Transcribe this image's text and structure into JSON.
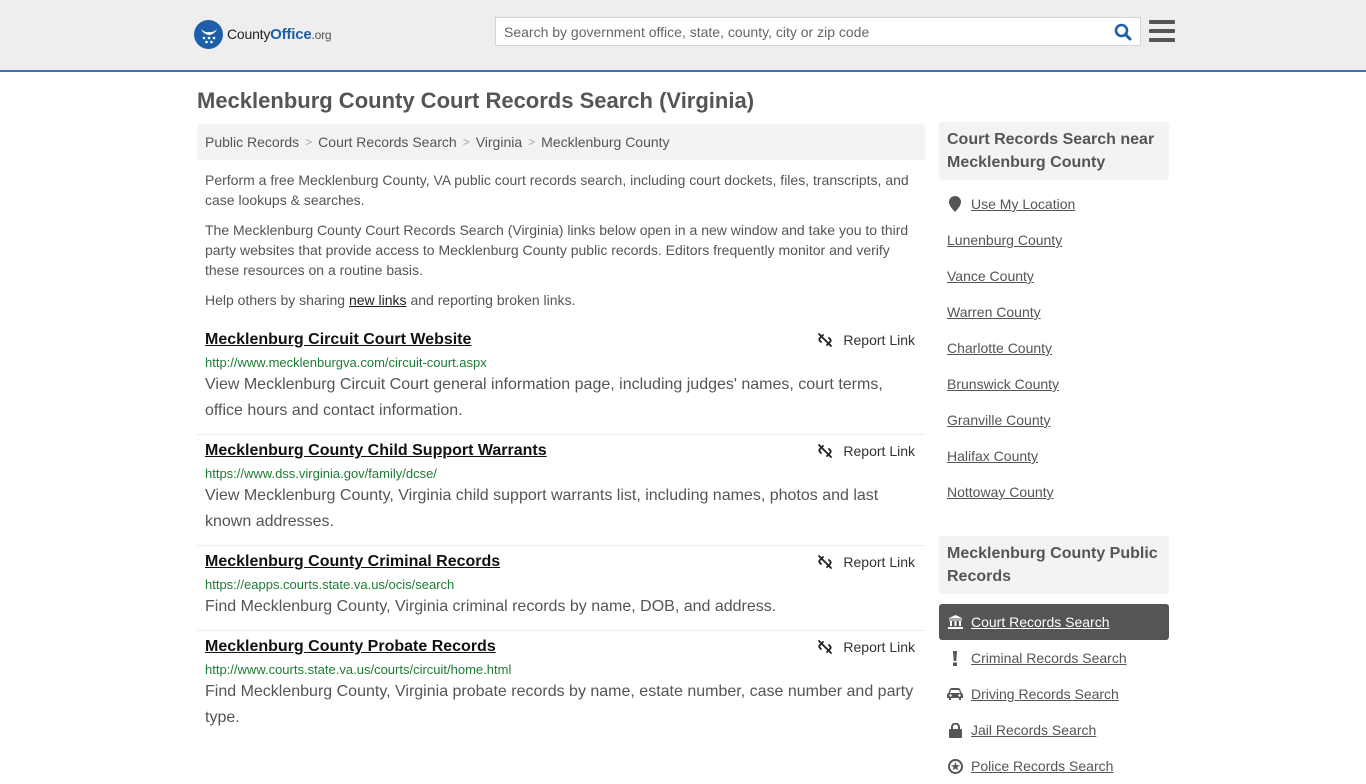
{
  "header": {
    "logo": {
      "county": "County",
      "office": "Office",
      "org": ".org"
    },
    "search": {
      "placeholder": "Search by government office, state, county, city or zip code",
      "value": ""
    },
    "colors": {
      "brand": "#1d5fa8",
      "border_accent": "#3a77b5"
    }
  },
  "page": {
    "title": "Mecklenburg County Court Records Search (Virginia)"
  },
  "breadcrumb": [
    {
      "label": "Public Records"
    },
    {
      "label": "Court Records Search"
    },
    {
      "label": "Virginia"
    },
    {
      "label": "Mecklenburg County"
    }
  ],
  "intro": {
    "p1": "Perform a free Mecklenburg County, VA public court records search, including court dockets, files, transcripts, and case lookups & searches.",
    "p2": "The Mecklenburg County Court Records Search (Virginia) links below open in a new window and take you to third party websites that provide access to Mecklenburg County public records. Editors frequently monitor and verify these resources on a routine basis.",
    "p3_before": "Help others by sharing ",
    "p3_link": "new links",
    "p3_after": " and reporting broken links."
  },
  "results": [
    {
      "title": "Mecklenburg Circuit Court Website",
      "url": "http://www.mecklenburgva.com/circuit-court.aspx",
      "description": "View Mecklenburg Circuit Court general information page, including judges' names, court terms, office hours and contact information.",
      "report_label": "Report Link"
    },
    {
      "title": "Mecklenburg County Child Support Warrants",
      "url": "https://www.dss.virginia.gov/family/dcse/",
      "description": "View Mecklenburg County, Virginia child support warrants list, including names, photos and last known addresses.",
      "report_label": "Report Link"
    },
    {
      "title": "Mecklenburg County Criminal Records",
      "url": "https://eapps.courts.state.va.us/ocis/search",
      "description": "Find Mecklenburg County, Virginia criminal records by name, DOB, and address.",
      "report_label": "Report Link"
    },
    {
      "title": "Mecklenburg County Probate Records",
      "url": "http://www.courts.state.va.us/courts/circuit/home.html",
      "description": "Find Mecklenburg County, Virginia probate records by name, estate number, case number and party type.",
      "report_label": "Report Link"
    }
  ],
  "sidebar": {
    "nearby": {
      "heading": "Court Records Search near Mecklenburg County",
      "use_location": {
        "label": "Use My Location",
        "icon": "map-marker-icon"
      },
      "items": [
        {
          "label": "Lunenburg County"
        },
        {
          "label": "Vance County"
        },
        {
          "label": "Warren County"
        },
        {
          "label": "Charlotte County"
        },
        {
          "label": "Brunswick County"
        },
        {
          "label": "Granville County"
        },
        {
          "label": "Halifax County"
        },
        {
          "label": "Nottoway County"
        }
      ]
    },
    "public_records": {
      "heading": "Mecklenburg County Public Records",
      "items": [
        {
          "label": "Court Records Search",
          "icon": "courthouse-icon",
          "active": true
        },
        {
          "label": "Criminal Records Search",
          "icon": "exclamation-icon"
        },
        {
          "label": "Driving Records Search",
          "icon": "car-icon"
        },
        {
          "label": "Jail Records Search",
          "icon": "lock-icon"
        },
        {
          "label": "Police Records Search",
          "icon": "police-badge-icon"
        }
      ]
    }
  }
}
